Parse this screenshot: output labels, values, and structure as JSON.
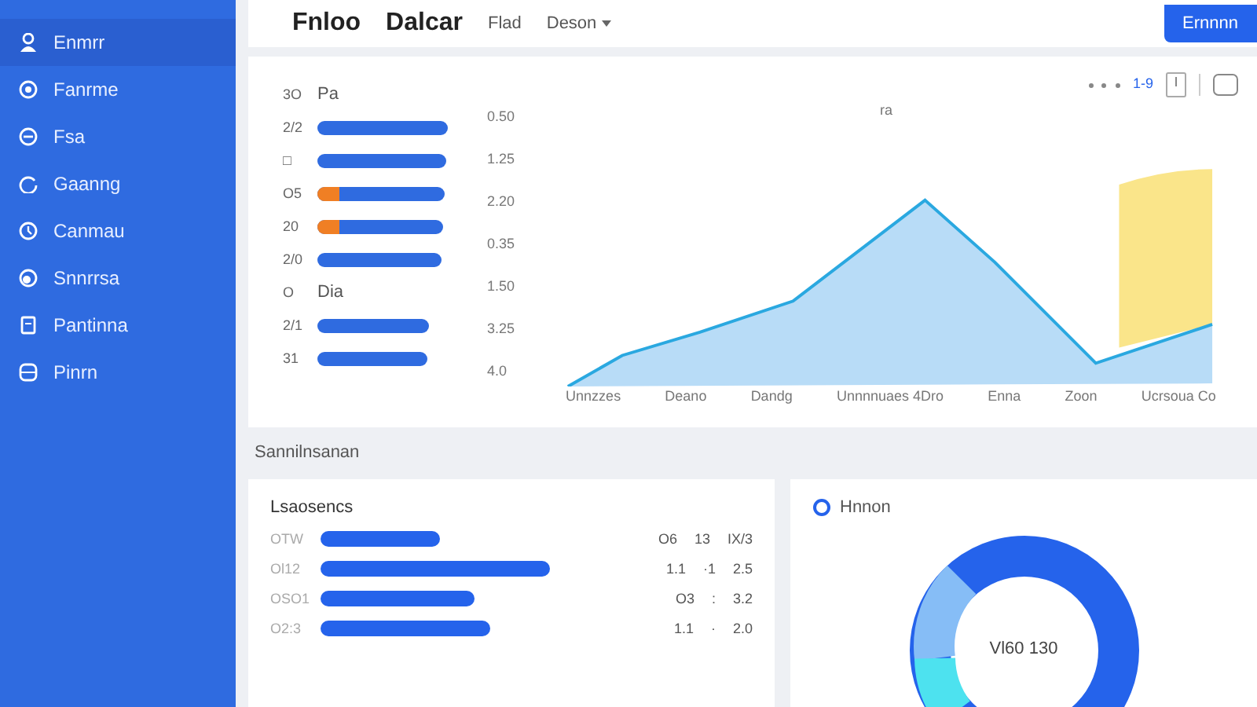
{
  "sidebar": {
    "items": [
      {
        "label": "Enmrr",
        "selected": true
      },
      {
        "label": "Fanrme",
        "selected": false
      },
      {
        "label": "Fsa",
        "selected": false
      },
      {
        "label": "Gaanng",
        "selected": false
      },
      {
        "label": "Canmau",
        "selected": false
      },
      {
        "label": "Snnrrsa",
        "selected": false
      },
      {
        "label": "Pantinna",
        "selected": false
      },
      {
        "label": "Pinrn",
        "selected": false
      }
    ]
  },
  "header": {
    "title": "Fnloo",
    "subtitle": "Dalcar",
    "filter": "Flad",
    "dropdown": "Deson",
    "button": "Ernnnn"
  },
  "overview": {
    "toolbar_text": "1-9",
    "list_header": {
      "code": "3O",
      "label": "Pa"
    },
    "rows": [
      {
        "code": "2/2",
        "kind": "bar",
        "highlight": false
      },
      {
        "code": "□",
        "kind": "bar",
        "highlight": false
      },
      {
        "code": "O5",
        "kind": "bar",
        "highlight": true
      },
      {
        "code": "20",
        "kind": "bar",
        "highlight": true
      },
      {
        "code": "2/0",
        "kind": "bar",
        "highlight": false
      },
      {
        "code": "O",
        "kind": "text",
        "text": "Dia"
      },
      {
        "code": "2/1",
        "kind": "bar",
        "highlight": false
      },
      {
        "code": "31",
        "kind": "bar",
        "highlight": false
      }
    ],
    "y_labels": [
      "0.50",
      "1.25",
      "2.20",
      "0.35",
      "1.50",
      "3.25",
      "4.0"
    ],
    "peak_label": "ra",
    "x_labels": [
      "Unnzzes",
      "Deano",
      "Dandg",
      "Unnnnuaes 4Dro",
      "Enna",
      "Zoon",
      "Ucrsoua Co"
    ]
  },
  "section_title": "Sannilnsanan",
  "bars_card": {
    "title": "Lsaosencs",
    "rows": [
      {
        "label": "OTW",
        "values": [
          "O6",
          "13",
          "IX/3"
        ]
      },
      {
        "label": "Ol12",
        "values": [
          "1.1",
          "·1",
          "2.5"
        ]
      },
      {
        "label": "OSO1",
        "values": [
          "O3",
          ":",
          "3.2"
        ]
      },
      {
        "label": "O2:3",
        "values": [
          "1.1",
          "·",
          "2.0"
        ]
      }
    ]
  },
  "donut_card": {
    "title": "Hnnon",
    "center_text": "Vl60 130"
  }
}
